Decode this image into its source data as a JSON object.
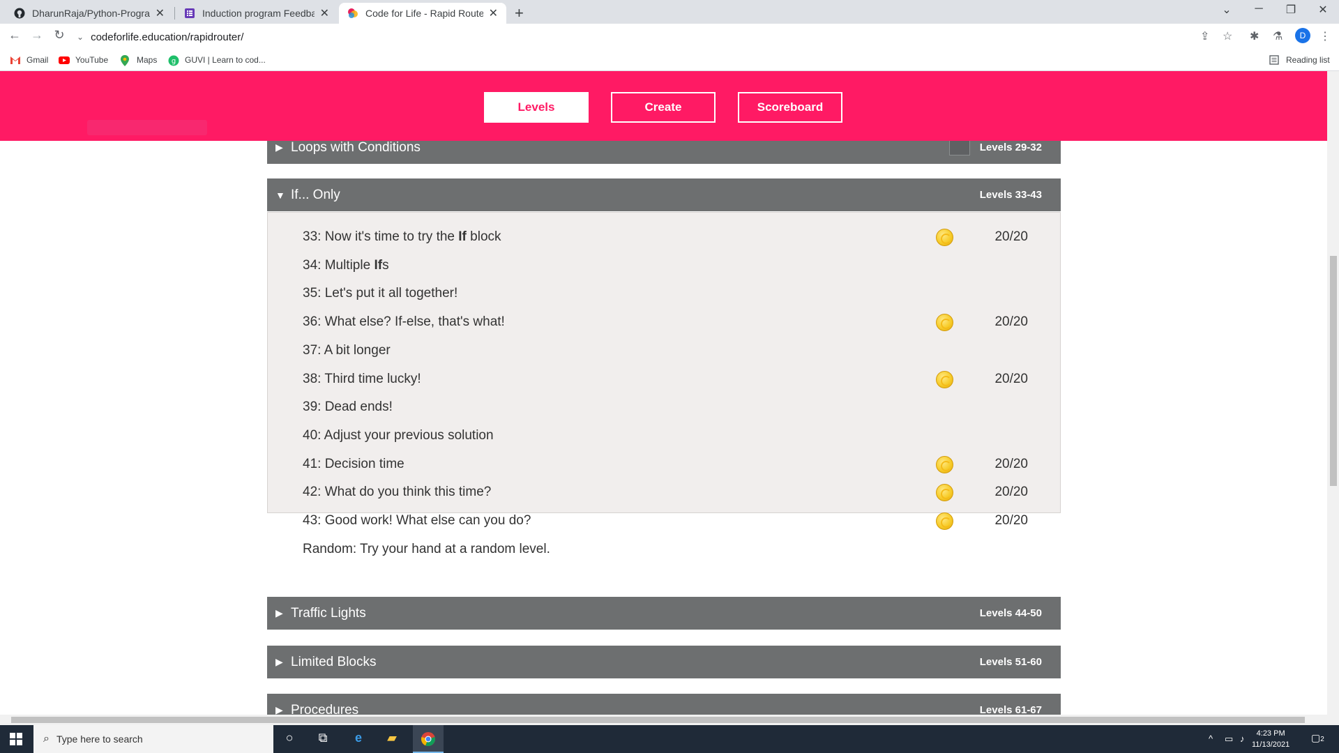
{
  "browser": {
    "tabs": [
      {
        "title": "DharunRaja/Python-Programmin",
        "close": "✕",
        "icon": "github-icon"
      },
      {
        "title": "Induction program Feedback",
        "close": "✕",
        "icon": "forms-icon"
      },
      {
        "title": "Code for Life - Rapid Router",
        "close": "✕",
        "icon": "codeforlife-icon"
      }
    ],
    "new_tab": "+",
    "address": "codeforlife.education/rapidrouter/",
    "bookmarks": [
      {
        "label": "Gmail",
        "icon": "gmail-icon"
      },
      {
        "label": "YouTube",
        "icon": "youtube-icon"
      },
      {
        "label": "Maps",
        "icon": "maps-icon"
      },
      {
        "label": "GUVI | Learn to cod...",
        "icon": "guvi-icon"
      }
    ],
    "reading_list": "Reading list",
    "profile_initial": "D"
  },
  "menu": {
    "levels": "Levels",
    "create": "Create",
    "scoreboard": "Scoreboard"
  },
  "episodes": {
    "loops_conditions": {
      "title": "Loops with Conditions",
      "range": "Levels 29-32"
    },
    "if_only": {
      "title": "If... Only",
      "range": "Levels 33-43"
    },
    "traffic_lights": {
      "title": "Traffic Lights",
      "range": "Levels 44-50"
    },
    "limited_blocks": {
      "title": "Limited Blocks",
      "range": "Levels 51-60"
    },
    "procedures": {
      "title": "Procedures",
      "range": "Levels 61-67"
    }
  },
  "levels": [
    {
      "prefix": "33: Now it's time to try the ",
      "bold": "If",
      "suffix": " block",
      "score": "20/20",
      "coin": true
    },
    {
      "prefix": "34: Multiple ",
      "bold": "If",
      "suffix": "s",
      "score": "",
      "coin": false
    },
    {
      "prefix": "35: Let's put it all together!",
      "bold": "",
      "suffix": "",
      "score": "",
      "coin": false
    },
    {
      "prefix": "36: What else? If-else, that's what!",
      "bold": "",
      "suffix": "",
      "score": "20/20",
      "coin": true
    },
    {
      "prefix": "37: A bit longer",
      "bold": "",
      "suffix": "",
      "score": "",
      "coin": false
    },
    {
      "prefix": "38: Third time lucky!",
      "bold": "",
      "suffix": "",
      "score": "20/20",
      "coin": true
    },
    {
      "prefix": "39: Dead ends!",
      "bold": "",
      "suffix": "",
      "score": "",
      "coin": false
    },
    {
      "prefix": "40: Adjust your previous solution",
      "bold": "",
      "suffix": "",
      "score": "",
      "coin": false
    },
    {
      "prefix": "41: Decision time",
      "bold": "",
      "suffix": "",
      "score": "20/20",
      "coin": true
    },
    {
      "prefix": "42: What do you think this time?",
      "bold": "",
      "suffix": "",
      "score": "20/20",
      "coin": true
    },
    {
      "prefix": "43: Good work! What else can you do?",
      "bold": "",
      "suffix": "",
      "score": "20/20",
      "coin": true
    },
    {
      "prefix": "Random: Try your hand at a random level.",
      "bold": "",
      "suffix": "",
      "score": "",
      "coin": false
    }
  ],
  "taskbar": {
    "search_placeholder": "Type here to search",
    "time": "4:23 PM",
    "date": "11/13/2021",
    "notifications": "2"
  },
  "colors": {
    "brand_pink": "#ff1a64",
    "episode_grey": "#6d6f70",
    "panel_bg": "#f1eeed"
  }
}
